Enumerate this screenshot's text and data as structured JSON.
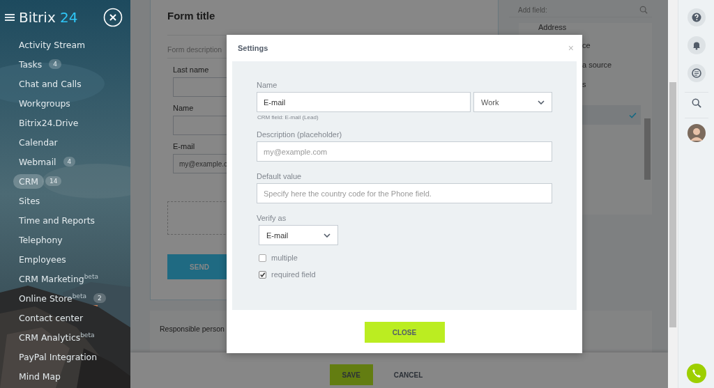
{
  "sidebar": {
    "logo": {
      "name": "Bitrix",
      "number": "24"
    },
    "items": [
      {
        "label": "Activity Stream",
        "selected": false
      },
      {
        "label": "Tasks",
        "badge": "4",
        "selected": false
      },
      {
        "label": "Chat and Calls",
        "selected": false
      },
      {
        "label": "Workgroups",
        "selected": false
      },
      {
        "label": "Bitrix24.Drive",
        "selected": false
      },
      {
        "label": "Calendar",
        "selected": false
      },
      {
        "label": "Webmail",
        "badge": "4",
        "selected": false
      },
      {
        "label": "CRM",
        "badge": "14",
        "selected": true
      },
      {
        "label": "Sites",
        "selected": false
      },
      {
        "label": "Time and Reports",
        "selected": false
      },
      {
        "label": "Telephony",
        "selected": false
      },
      {
        "label": "Employees",
        "selected": false
      },
      {
        "label": "CRM Marketing$^{beta}$",
        "selected": false
      },
      {
        "label": "Online Store$^{beta}$",
        "badge": "2",
        "selected": false
      },
      {
        "label": "Contact center",
        "selected": false
      },
      {
        "label": "CRM Analytics$^{beta}$",
        "selected": false
      },
      {
        "label": "PayPal Integration",
        "selected": false
      },
      {
        "label": "Mind Map",
        "selected": false
      }
    ]
  },
  "form": {
    "title": "Form title",
    "description_placeholder": "Form description",
    "fields": [
      {
        "label": "Last name"
      },
      {
        "label": "Name"
      },
      {
        "label": "E-mail",
        "placeholder": "my@example.c"
      }
    ],
    "send_button": "SEND",
    "responsible_label": "Responsible person"
  },
  "field_list": {
    "title": "Add field:",
    "items": [
      {
        "text": "Address",
        "selected": false
      },
      {
        "text": "ce",
        "selected": false
      },
      {
        "text": "a source",
        "selected": false
      },
      {
        "text": "s",
        "selected": false
      },
      {
        "selected": true
      }
    ]
  },
  "footer": {
    "save": "SAVE",
    "cancel": "CANCEL"
  },
  "dialog": {
    "title": "Settings",
    "close_symbol": "×",
    "name": {
      "label": "Name",
      "value": "E-mail",
      "type": "Work",
      "hint": "CRM field: E-mail (Lead)"
    },
    "description": {
      "label": "Description (placeholder)",
      "placeholder": "my@example.com"
    },
    "default_value": {
      "label": "Default value",
      "placeholder": "Specify here the country code for the Phone field."
    },
    "verify": {
      "label": "Verify as",
      "value": "E-mail"
    },
    "options": [
      {
        "label": "multiple",
        "checked": false
      },
      {
        "label": "required field",
        "checked": true
      }
    ],
    "close_button": "CLOSE"
  }
}
